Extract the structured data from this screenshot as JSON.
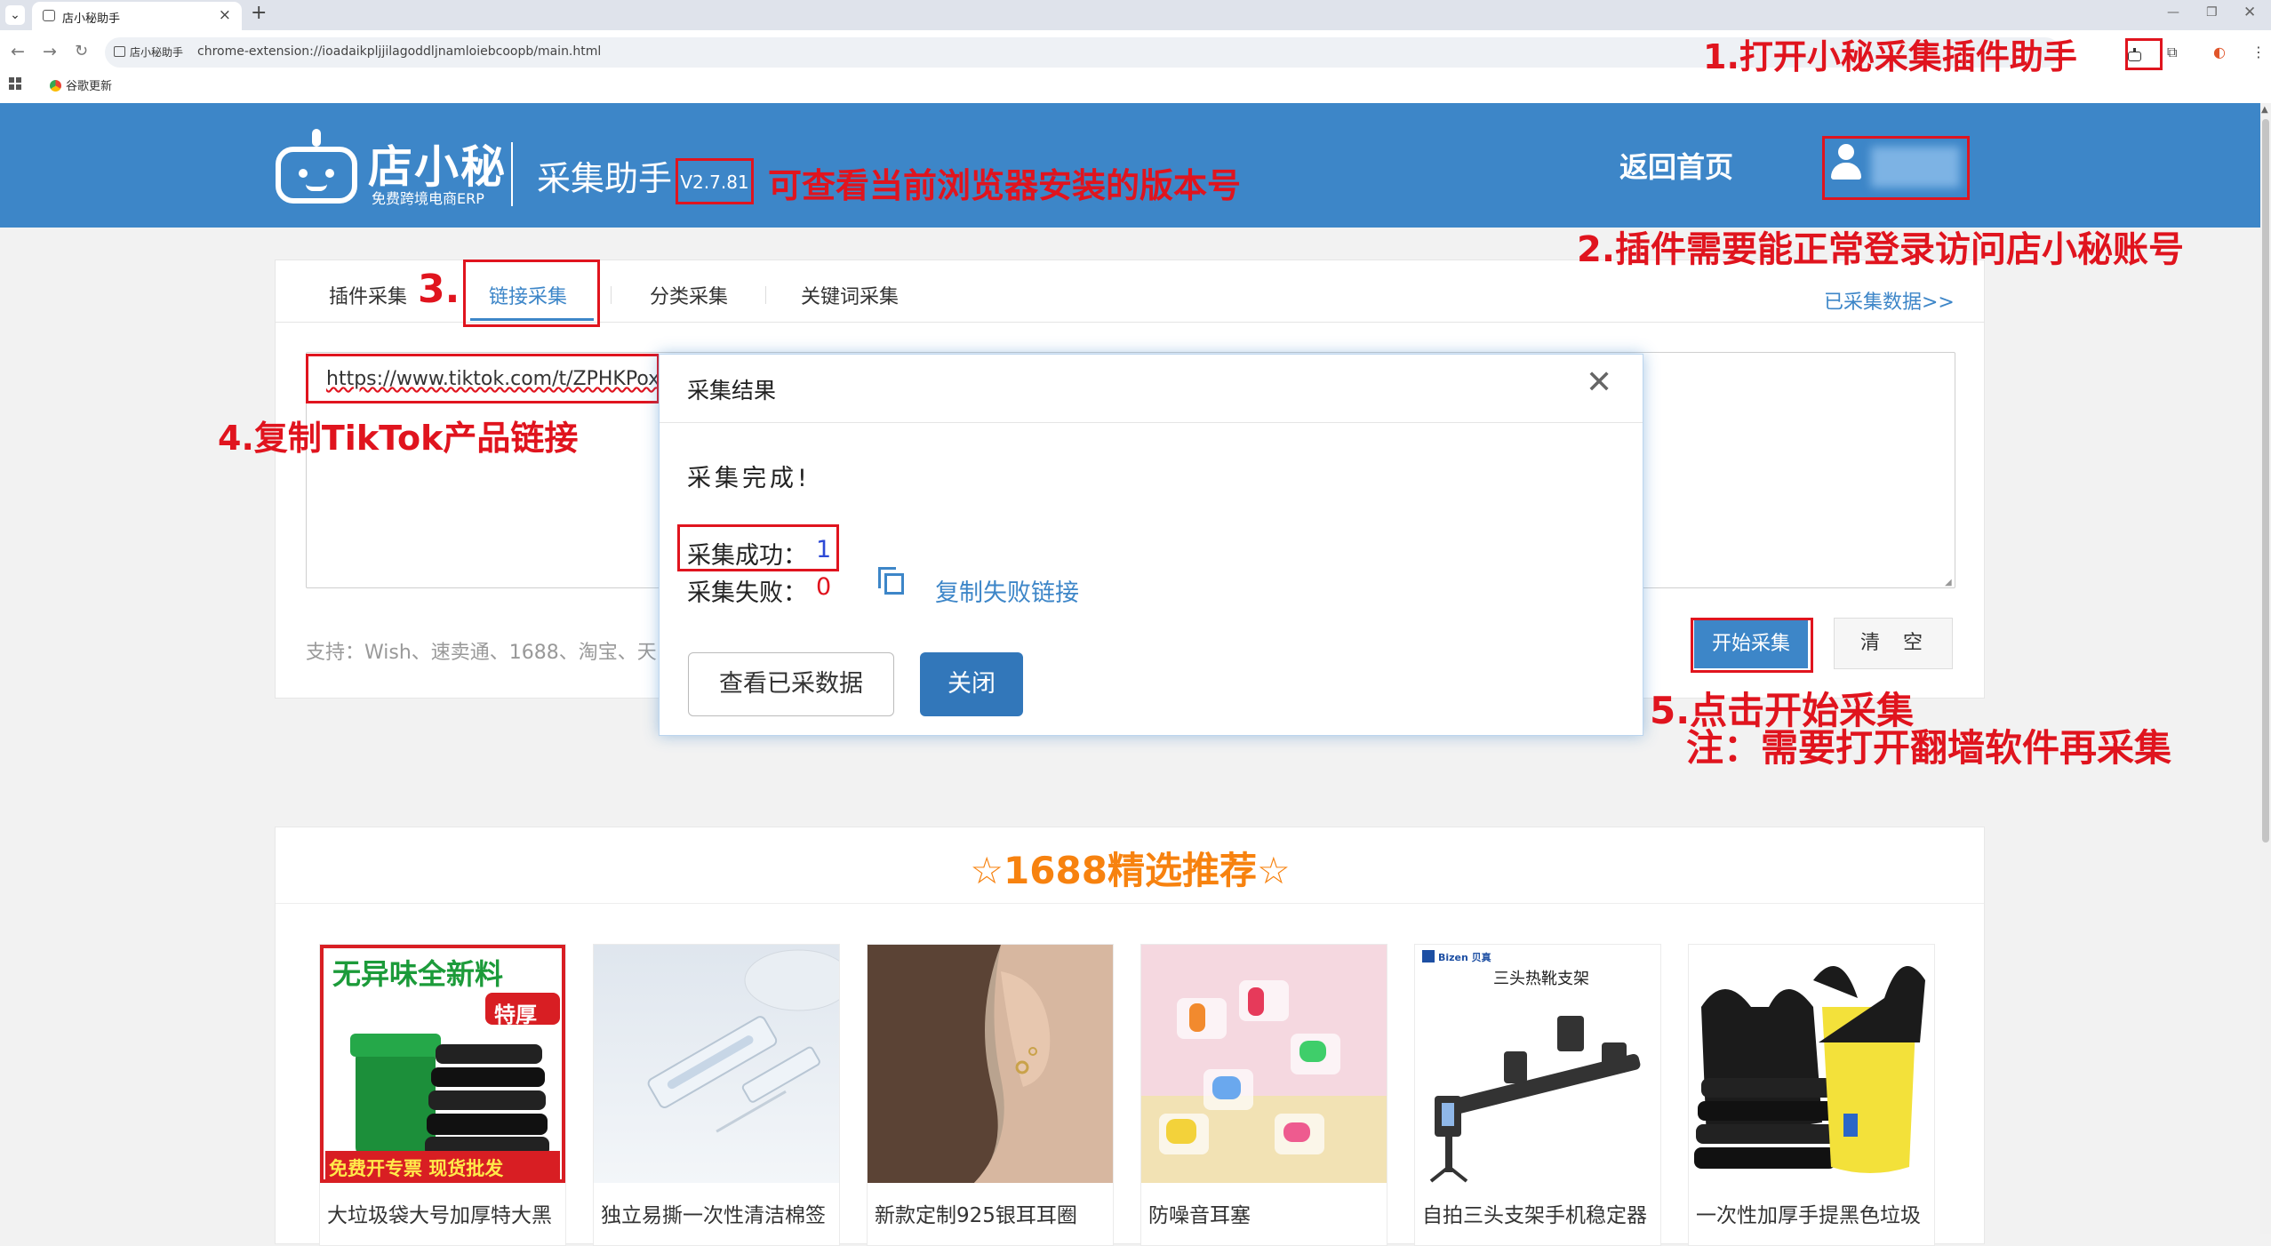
{
  "browser": {
    "tab_title": "店小秘助手",
    "site_chip": "店小秘助手",
    "url": "chrome-extension://ioadaikpljjilagoddljnamloiebcoopb/main.html",
    "bookmark": "谷歌更新"
  },
  "header": {
    "logo_name": "店小秘",
    "logo_sub": "免费跨境电商ERP",
    "app_name": "采集助手",
    "version": "V2.7.81",
    "home_link": "返回首页"
  },
  "tabs": {
    "plugin": "插件采集",
    "link": "链接采集",
    "category": "分类采集",
    "keyword": "关键词采集",
    "collected_link": "已采集数据>>"
  },
  "main": {
    "url_value": "https://www.tiktok.com/t/ZPHKPoxFfB",
    "support_text": "支持：Wish、速卖通、1688、淘宝、天",
    "start_button": "开始采集",
    "clear_button": "清空"
  },
  "dialog": {
    "title": "采集结果",
    "close": "✕",
    "done": "采集完成!",
    "success_label": "采集成功：",
    "success_count": "1",
    "fail_label": "采集失败：",
    "fail_count": "0",
    "copy_fail_link": "复制失败链接",
    "view_button": "查看已采数据",
    "close_button": "关闭"
  },
  "recommend": {
    "title": "☆1688精选推荐☆",
    "products": [
      {
        "name": "大垃圾袋大号加厚特大黑",
        "badge_top": "无异味全新料",
        "badge_mid": "特厚",
        "badge_bottom": "免费开专票 现货批发"
      },
      {
        "name": "独立易撕一次性清洁棉签"
      },
      {
        "name": "新款定制925银耳耳圈"
      },
      {
        "name": "防噪音耳塞"
      },
      {
        "name": "自拍三头支架手机稳定器",
        "brand": "Bizen 贝真",
        "heading": "三头热靴支架"
      },
      {
        "name": "一次性加厚手提黑色垃圾"
      }
    ]
  },
  "annotations": {
    "step1": "1.打开小秘采集插件助手",
    "version_note": "可查看当前浏览器安装的版本号",
    "step2": "2.插件需要能正常登录访问店小秘账号",
    "step3": "3.",
    "step4": "4.复制TikTok产品链接",
    "step5": "5.点击开始采集",
    "note": "注：需要打开翻墙软件再采集"
  },
  "colors": {
    "header_bg": "#3d86c8",
    "annotation_red": "#e0141e",
    "link_blue": "#3d86c8",
    "recommend_orange": "#f7820f"
  }
}
